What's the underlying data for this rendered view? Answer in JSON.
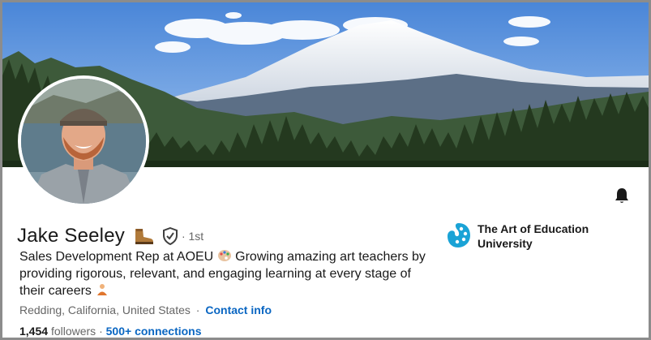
{
  "profile": {
    "name": "Jake Seeley",
    "degree": "· 1st",
    "headline_part1": "Sales Development Rep at AOEU",
    "headline_part2": "Growing amazing art teachers by providing rigorous, relevant, and engaging learning at every stage of their careers",
    "location": "Redding, California, United States",
    "separator": "·",
    "contact_label": "Contact info",
    "followers_count": "1,454",
    "followers_label": "followers",
    "connections_label": "500+ connections",
    "name_emoji": "hiking-boot",
    "headline_emojis": [
      "palette",
      "teacher"
    ]
  },
  "company": {
    "name": "The Art of Education University",
    "logo_color": "#1aa3d6"
  },
  "icons": {
    "bell": "bell-icon",
    "verified": "shield-check-icon"
  },
  "colors": {
    "link": "#0a66c2",
    "text": "#191919",
    "muted": "#666666"
  }
}
